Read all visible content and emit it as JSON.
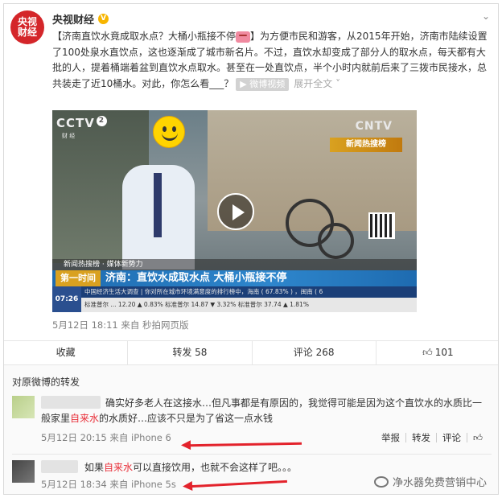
{
  "post": {
    "author": "央视财经",
    "verified_badge": "V",
    "avatar_text_line1": "央视",
    "avatar_text_line2": "财经",
    "title": "【济南直饮水竟成取水点？大桶小瓶接不停",
    "title_end": "】",
    "body": "为方便市民和游客，从2015年开始，济南市陆续设置了100处泉水直饮点，这也逐渐成了城市新名片。不过，直饮水却变成了部分人的取水点，每天都有大批的人，提着桶端着盆到直饮水点取水。甚至在一处直饮点，半个小时内就前后来了三拨市民接水，总共装走了近10桶水。对此，你怎么看___？",
    "video_chip": "微博视频",
    "expand_link": "展开全文",
    "expand_icon": "chevron-down-icon",
    "meta": "5月12日 18:11 来自 秒拍网页版"
  },
  "video": {
    "logo_cctv": "CCTV",
    "logo_num": "2",
    "logo_sub": "财 经",
    "logo_cntv": "CNTV",
    "news_badge": "新闻热搜榜",
    "ticker1": "新闻热搜榜 · 媒体新势力",
    "tag": "第一时间",
    "headline": "济南：直饮水成取水点 大桶小瓶接不停",
    "ticker3": "中国经济生活大调查 | 你对所在城市环境满意度的排行榜中，海南 ( 67.83% ) ，闽南 ( 6",
    "ticker4": "标准普尔 ... 12.20 ▲ 0.83%  标准普尔 14.87 ▼ 3.32%  标准普尔 37.74 ▲ 1.81%",
    "clock": "07:26"
  },
  "actions": {
    "collect": "收藏",
    "repost": "转发 58",
    "comment": "评论 268",
    "like": "101",
    "like_icon": "thumbs-up-icon"
  },
  "reposts": {
    "header": "对原微博的转发",
    "items": [
      {
        "text_pre": "确实好多老人在这接水…但凡事都是有原因的，我觉得可能是因为这个直饮水的水质比一般家里",
        "highlight": "自来水",
        "text_post": "的水质好…应该不只是为了省这一点水钱",
        "meta": "5月12日 20:15 来自 iPhone 6",
        "actions": [
          "举报",
          "转发",
          "评论"
        ]
      },
      {
        "text_pre": "如果",
        "highlight": "自来水",
        "text_post": "可以直接饮用，也就不会这样了吧。。。",
        "meta": "5月12日 18:34 来自 iPhone 5s"
      }
    ]
  },
  "watermark": "净水器免费营销中心",
  "colors": {
    "accent_red": "#e8303a",
    "brand_red": "#d4262a",
    "news_blue": "#1e6bb0"
  }
}
